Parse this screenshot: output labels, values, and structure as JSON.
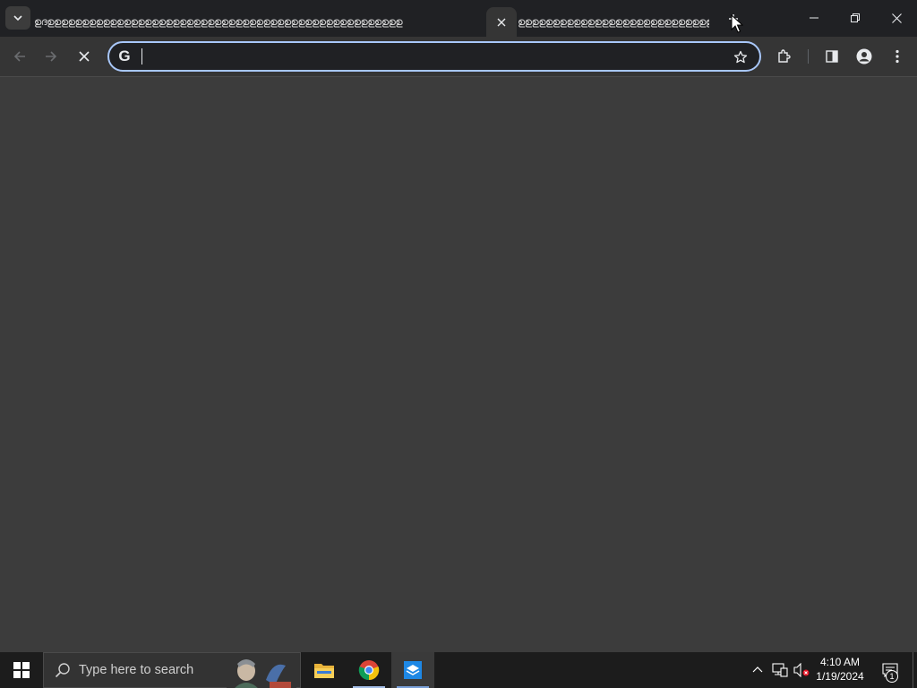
{
  "colors": {
    "frame": "#202124",
    "toolbar": "#353535",
    "content": "#3c3c3c",
    "omnibox_focus": "#a8c7fa",
    "taskbar": "#1c1c1c"
  },
  "tabs": [
    {
      "title": "ഉദഉഉഉഉഉഉഉഉഉഉഉഉഉഉഉഉഉഉഉഉഉഉഉഉഉഉഉഉഉഉഉഉഉഉഉഉഉഉഉഉഉഉഉഉഉഉഉഉഉഉഉ",
      "icon": "favicon"
    },
    {
      "title": "",
      "icon": "close-icon",
      "active": true
    },
    {
      "title": "ഉഉഉഉഉഉഉഉഉഉഉഉഉഉഉഉഉഉഉഉഉഉഉഉഉഉഉഉ",
      "icon": "favicon"
    }
  ],
  "omnibox": {
    "value": "",
    "placeholder": "",
    "icon": "google-g-icon"
  },
  "toolbar_icons": [
    "back-arrow-icon",
    "forward-arrow-icon",
    "stop-loading-icon",
    "star-icon",
    "extensions-puzzle-icon",
    "side-panel-icon",
    "profile-icon",
    "menu-dots-icon"
  ],
  "taskbar": {
    "search_text": "Type here to search",
    "apps": [
      "file-explorer-icon",
      "chrome-icon",
      "app-icon"
    ],
    "time": "4:10 AM",
    "date": "1/19/2024",
    "notification_count": "1"
  }
}
